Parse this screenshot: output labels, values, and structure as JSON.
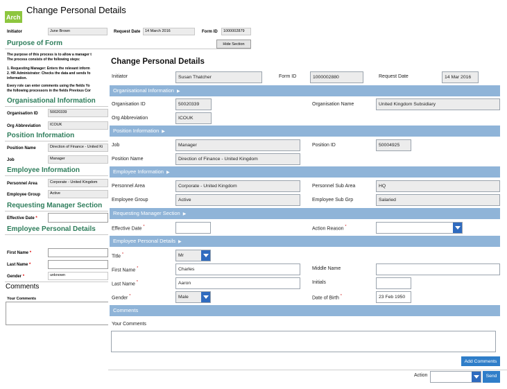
{
  "background_form": {
    "logo_text": "Arch",
    "title": "Change Personal Details",
    "header": {
      "initiator_label": "Initiator",
      "initiator_value": "June Brown",
      "request_date_label": "Request Date",
      "request_date_value": "14 March 2016",
      "form_id_label": "Form ID",
      "form_id_value": "1000002879"
    },
    "purpose_heading": "Purpose of Form",
    "hide_section_label": "Hide Section",
    "purpose_lines": [
      "The purpose of this process is to allow a manager t",
      "The process consists of the following steps:",
      "1. Requesting Manager: Enters the relevant inform",
      "2. HR Administrator: Checks the data and sends fo",
      "information.",
      "Every role can enter comments using the fields Yo",
      "the following processors in the fields Previous Cor"
    ],
    "org_heading": "Organisational Information",
    "org_id_label": "Organisation ID",
    "org_id_value": "50020339",
    "org_abbrev_label": "Org Abbreviation",
    "org_abbrev_value": "ICOUK",
    "position_heading": "Position Information",
    "position_name_label": "Position Name",
    "position_name_value": "Direction of Finance - United Ki",
    "job_label": "Job",
    "job_value": "Manager",
    "employee_heading": "Employee Information",
    "personnel_area_label": "Personnel Area",
    "personnel_area_value": "Corporate - United Kingdom",
    "employee_group_label": "Employee Group",
    "employee_group_value": "Active",
    "req_mgr_heading": "Requesting Manager Section",
    "effective_date_label": "Effective Date",
    "personal_heading": "Employee Personal Details",
    "first_name_label": "First Name",
    "last_name_label": "Last Name",
    "gender_label": "Gender",
    "gender_value": "unknown",
    "comments_heading": "Comments",
    "your_comments_label": "Your Comments"
  },
  "form": {
    "title": "Change Personal Details",
    "initiator_label": "Initiator",
    "initiator_value": "Susan Thatcher",
    "form_id_label": "Form ID",
    "form_id_value": "1000002880",
    "request_date_label": "Request Date",
    "request_date_value": "14 Mar 2016",
    "sections": {
      "org": "Organisational Information",
      "position": "Position Information",
      "employee": "Employee Information",
      "req_mgr": "Requesting Manager Section",
      "personal": "Employee Personal Details",
      "comments": "Comments"
    },
    "org": {
      "org_id_label": "Organisation ID",
      "org_id_value": "50020339",
      "org_name_label": "Organisation Name",
      "org_name_value": "United Kingdom Subsidiary",
      "org_abbrev_label": "Org Abbreviation",
      "org_abbrev_value": "ICOUK"
    },
    "position": {
      "job_label": "Job",
      "job_value": "Manager",
      "position_id_label": "Position ID",
      "position_id_value": "50004925",
      "position_name_label": "Position Name",
      "position_name_value": "Direction of Finance - United Kingdom"
    },
    "employee": {
      "personnel_area_label": "Personnel Area",
      "personnel_area_value": "Corporate - United Kingdom",
      "personnel_sub_area_label": "Personnel Sub Area",
      "personnel_sub_area_value": "HQ",
      "employee_group_label": "Employee Group",
      "employee_group_value": "Active",
      "employee_sub_grp_label": "Employee Sub Grp",
      "employee_sub_grp_value": "Salaried"
    },
    "req_mgr": {
      "effective_date_label": "Effective Date",
      "effective_date_value": "",
      "action_reason_label": "Action Reason",
      "action_reason_value": ""
    },
    "personal": {
      "title_label": "Title",
      "title_value": "Mr",
      "first_name_label": "First Name",
      "first_name_value": "Charles",
      "middle_name_label": "Middle Name",
      "middle_name_value": "",
      "last_name_label": "Last Name",
      "last_name_value": "Aaron",
      "initials_label": "Initials",
      "initials_value": "",
      "gender_label": "Gender",
      "gender_value": "Male",
      "dob_label": "Date of Birth",
      "dob_value": "23 Feb 1950"
    },
    "comments": {
      "your_comments_label": "Your Comments",
      "your_comments_value": "",
      "add_comments_label": "Add Comments"
    },
    "footer": {
      "action_label": "Action",
      "action_value": "",
      "send_label": "Send"
    },
    "required_marker": "*",
    "section_chevron": "▶"
  },
  "colors": {
    "section_header": "#8fb4d8",
    "dropdown_arrow": "#2f6bbf",
    "button": "#2f7ec9",
    "bg_heading": "#2e7d5b",
    "logo": "#8dc63f"
  }
}
